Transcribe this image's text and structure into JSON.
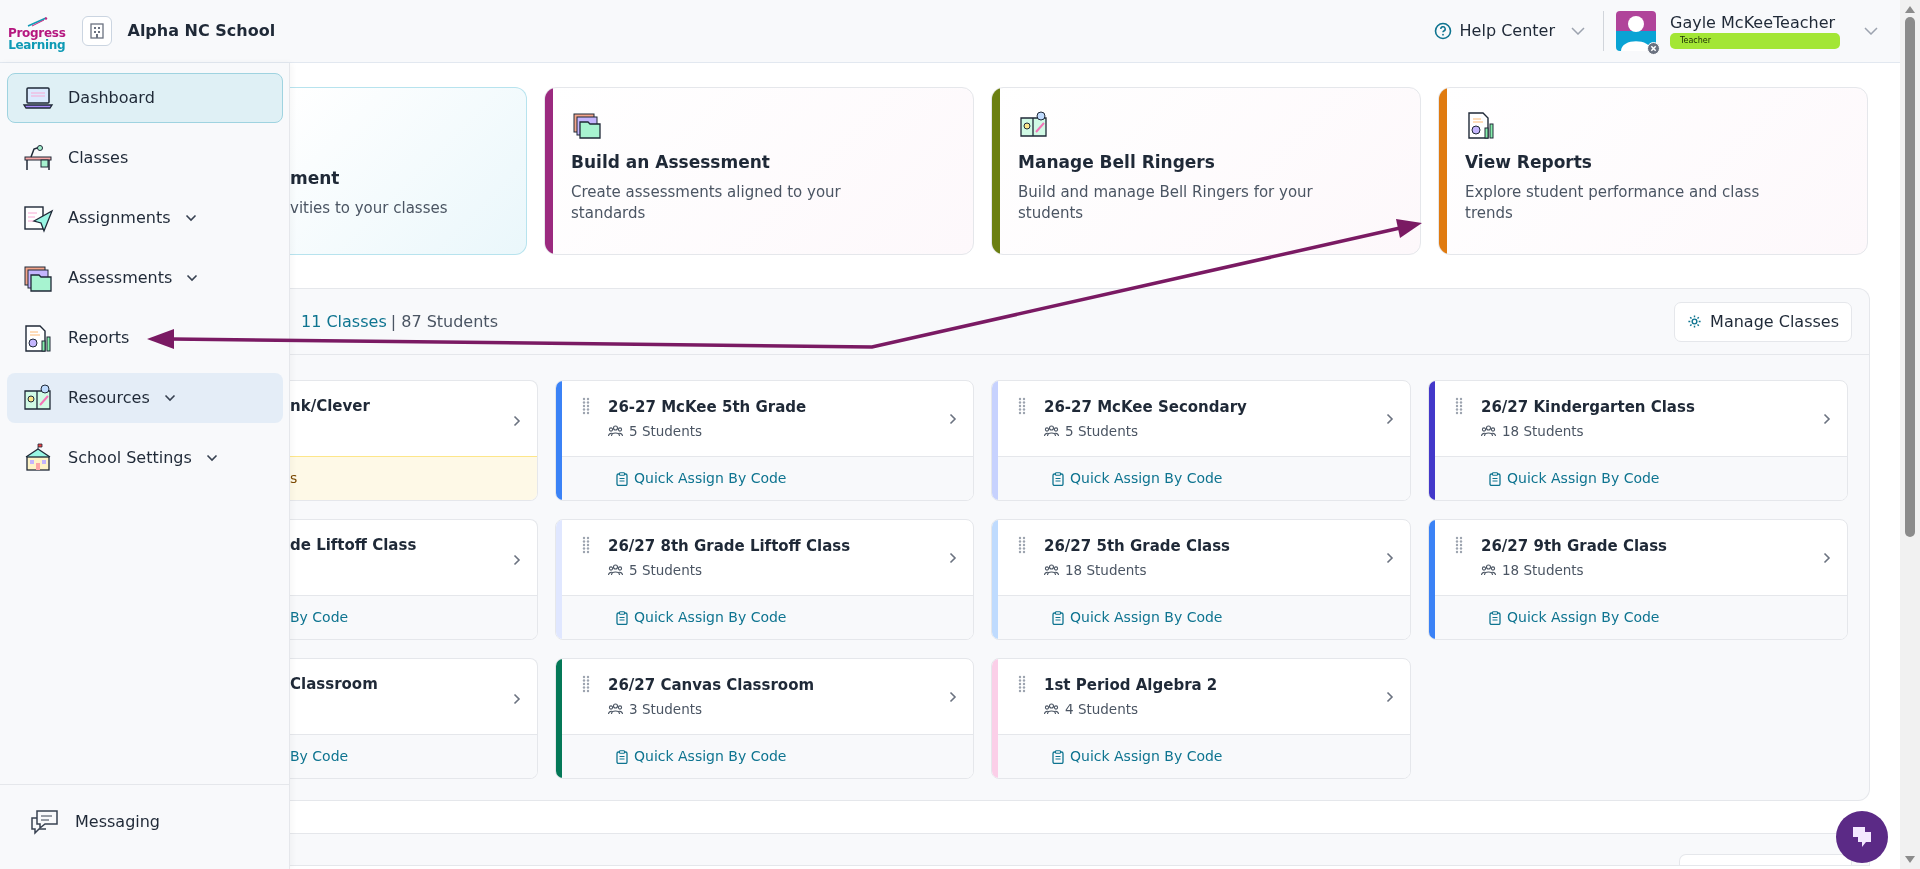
{
  "header": {
    "logo": [
      "Progress",
      "Learning"
    ],
    "school": "Alpha NC School",
    "help": "Help Center",
    "user": {
      "name": "Gayle McKeeTeacher",
      "role": "Teacher"
    }
  },
  "sidebar": {
    "items": [
      {
        "label": "Dashboard",
        "selected": true,
        "hovered": false,
        "expandable": false
      },
      {
        "label": "Classes",
        "selected": false,
        "hovered": false,
        "expandable": false
      },
      {
        "label": "Assignments",
        "selected": false,
        "hovered": false,
        "expandable": true
      },
      {
        "label": "Assessments",
        "selected": false,
        "hovered": false,
        "expandable": true
      },
      {
        "label": "Reports",
        "selected": false,
        "hovered": false,
        "expandable": false
      },
      {
        "label": "Resources",
        "selected": false,
        "hovered": true,
        "expandable": true
      },
      {
        "label": "School Settings",
        "selected": false,
        "hovered": false,
        "expandable": true
      }
    ],
    "footer_item": {
      "label": "Messaging"
    }
  },
  "action_cards": [
    {
      "kind": "cut",
      "title": "ment",
      "description": "vities to your classes"
    },
    {
      "kind": "full",
      "title": "Build an Assessment",
      "description": "Create assessments aligned to your standards",
      "color": "#9b2a7f"
    },
    {
      "kind": "full",
      "title": "Manage Bell Ringers",
      "description": "Build and manage Bell Ringers for your students",
      "color": "#6b7f12"
    },
    {
      "kind": "full",
      "title": "View Reports",
      "description": "Explore student performance and class trends",
      "color": "#e07b10"
    }
  ],
  "classes_panel": {
    "class_count": "11 Classes",
    "summary": "| 87 Students",
    "manage_button": "Manage Classes",
    "classes": [
      {
        "kind": "cut",
        "title": "nk/Clever",
        "footer": "s",
        "warning": true
      },
      {
        "kind": "full",
        "title": "26-27 McKee 5th Grade",
        "students": "5 Students",
        "footer": "Quick Assign By Code",
        "color": "#3b82f6",
        "warning": false
      },
      {
        "kind": "full",
        "title": "26-27 McKee Secondary",
        "students": "5 Students",
        "footer": "Quick Assign By Code",
        "color": "#c7d2fe",
        "warning": false
      },
      {
        "kind": "full",
        "title": "26/27 Kindergarten Class",
        "students": "18 Students",
        "footer": "Quick Assign By Code",
        "color": "#4338ca",
        "warning": false
      },
      {
        "kind": "cut",
        "title": "de Liftoff Class",
        "footer": "By Code",
        "warning": false
      },
      {
        "kind": "full",
        "title": "26/27 8th Grade Liftoff Class",
        "students": "5 Students",
        "footer": "Quick Assign By Code",
        "color": "#e0e7ff",
        "warning": false
      },
      {
        "kind": "full",
        "title": "26/27 5th Grade Class",
        "students": "18 Students",
        "footer": "Quick Assign By Code",
        "color": "#bfdbfe",
        "warning": false
      },
      {
        "kind": "full",
        "title": "26/27 9th Grade Class",
        "students": "18 Students",
        "footer": "Quick Assign By Code",
        "color": "#3b82f6",
        "warning": false
      },
      {
        "kind": "cut",
        "title": "Classroom",
        "footer": "By Code",
        "warning": false
      },
      {
        "kind": "full",
        "title": "26/27 Canvas Classroom",
        "students": "3 Students",
        "footer": "Quick Assign By Code",
        "color": "#047857",
        "warning": false
      },
      {
        "kind": "full",
        "title": "1st Period Algebra 2",
        "students": "4 Students",
        "footer": "Quick Assign By Code",
        "color": "#fbcfe8",
        "warning": false
      }
    ]
  }
}
